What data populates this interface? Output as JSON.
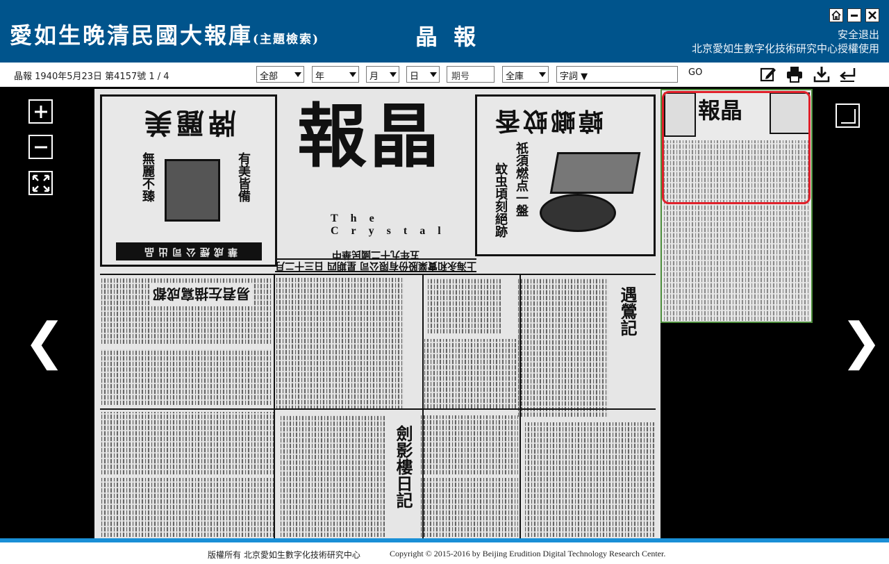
{
  "header": {
    "logo_main": "愛如生晚清民國大報庫",
    "logo_sub": "(主題檢索)",
    "paper_name": "晶 報",
    "logout": "安全退出",
    "license": "北京愛如生數字化技術研究中心授權使用",
    "window_buttons": [
      "home-icon",
      "minimize-icon",
      "close-icon"
    ]
  },
  "toolbar": {
    "issue_info": "晶報 1940年5月23日  第4157號  1 / 4",
    "selects": {
      "all": "全部",
      "year": "年",
      "month": "月",
      "day": "日",
      "library": "全庫",
      "word": "字詞 ▼"
    },
    "issue_no_placeholder": "期号",
    "search_value": "",
    "go_label": "GO",
    "tools": [
      "edit-icon",
      "print-icon",
      "download-icon",
      "return-icon"
    ]
  },
  "viewer": {
    "zoom_in": "+",
    "zoom_out": "−",
    "prev_arrow": "❮",
    "next_arrow": "❯"
  },
  "newspaper": {
    "masthead_chars": "報晶",
    "masthead_english": "The Crystal",
    "dateline": "上海永和實業股份有限公司    星期四 日三十二月五年九十二國民華中",
    "ad_left_title": "牌麗美",
    "ad_left_slogan": "無麗不臻",
    "ad_left_slogan2": "有美皆備",
    "ad_left_bottom": "華成煙公司出品",
    "ad_right_title": "蟑螂蚊香",
    "ad_right_slogan": "祇須燃点一盤",
    "ad_right_slogan2": "蚊虫頃刻絕跡",
    "headline_1": "易君左描寫成都",
    "headline_2": "遇鶯記",
    "headline_3": "劍影樓日記"
  },
  "footer": {
    "copyright_cn": "版權所有  北京愛如生數字化技術研究中心",
    "copyright_en": "Copyright © 2015-2016 by Beijing Erudition Digital Technology Research Center."
  }
}
